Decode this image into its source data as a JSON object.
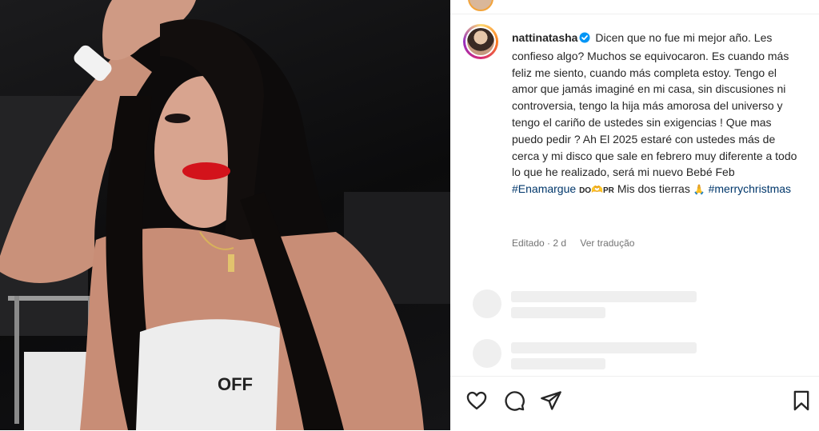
{
  "photo": {
    "shirt_text": "OFF"
  },
  "post": {
    "username": "nattinatasha",
    "caption_text": "Dicen que no fue mi mejor año. Les confieso algo? Muchos se equivocaron. Es cuando más feliz me siento, cuando más completa estoy. Tengo el amor que jamás imaginé en mi casa, sin discusiones ni controversia, tengo la hija más amorosa del universo y tengo el cariño de ustedes sin exigencias ! Que mas puedo pedir ? Ah El 2025 estaré con ustedes más de cerca y mi disco que sale en febrero muy diferente a todo lo que he realizado, será mi nuevo Bebé Feb",
    "hashtag_1": "#Enamargue",
    "flag_do": "DO",
    "flag_pr": "PR",
    "caption_after_flags": "Mis dos tierras",
    "hashtag_2": "#merrychristmas",
    "edited_label": "Editado · 2 d",
    "translate_label": "Ver tradução"
  },
  "icons": {
    "verified": "verified-badge-icon",
    "like": "heart-icon",
    "comment": "comment-icon",
    "share": "share-icon",
    "save": "bookmark-icon"
  },
  "colors": {
    "verified_blue": "#0095f6",
    "hashtag_blue": "#00376b",
    "meta_gray": "#737373",
    "skeleton_gray": "#efefef"
  }
}
